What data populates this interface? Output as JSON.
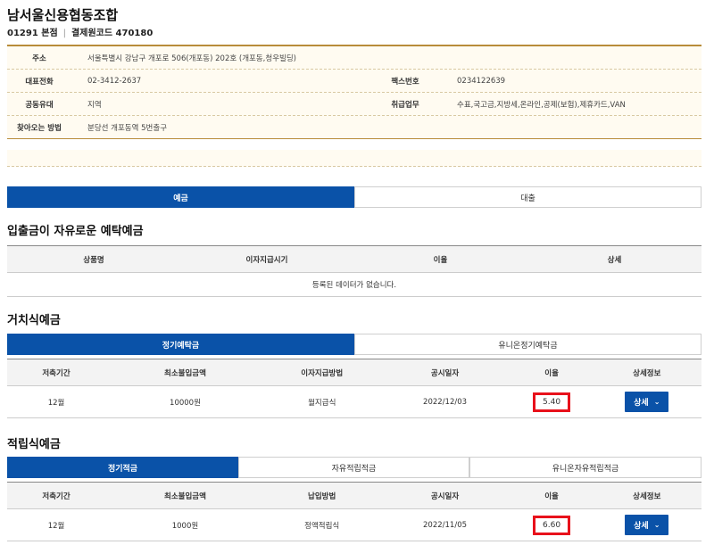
{
  "header": {
    "title": "남서울신용협동조합",
    "branch": "01291 본점",
    "separator": "|",
    "settlement_code": "결제원코드 470180"
  },
  "info": {
    "address_label": "주소",
    "address": "서울특별시 강남구 개포로 506(개포동) 202호 (개포동,청우빌딩)",
    "phone_label": "대표전화",
    "phone": "02-3412-2637",
    "fax_label": "팩스번호",
    "fax": "0234122639",
    "union_label": "공동유대",
    "union": "지역",
    "business_label": "취급업무",
    "business": "수표,국고금,지방세,온라인,공제(보험),제휴카드,VAN",
    "directions_label": "찾아오는 방법",
    "directions": "분당선 개포동역 5번출구"
  },
  "main_tabs": [
    "예금",
    "대출"
  ],
  "section1": {
    "title": "입출금이 자유로운 예탁예금",
    "columns": [
      "상품명",
      "이자지급시기",
      "이율",
      "상세"
    ],
    "empty_message": "등록된 데이터가 없습니다."
  },
  "section2": {
    "title": "거치식예금",
    "tabs": [
      "정기예탁금",
      "유니온정기예탁금"
    ],
    "columns": [
      "저축기간",
      "최소불입금액",
      "이자지급방법",
      "공시일자",
      "이율",
      "상세정보"
    ],
    "row": {
      "period": "12월",
      "min_amount": "10000원",
      "method": "월지급식",
      "date": "2022/12/03",
      "rate": "5.40",
      "detail": "상세"
    }
  },
  "section3": {
    "title": "적립식예금",
    "tabs": [
      "정기적금",
      "자유적립적금",
      "유니온자유적립적금"
    ],
    "columns": [
      "저축기간",
      "최소불입금액",
      "납입방법",
      "공시일자",
      "이율",
      "상세정보"
    ],
    "row": {
      "period": "12월",
      "min_amount": "1000원",
      "method": "정액적립식",
      "date": "2022/11/05",
      "rate": "6.60",
      "detail": "상세"
    }
  },
  "icons": {
    "detail_chevron": "chevron-down-icon"
  },
  "colors": {
    "primary": "#0a52a8",
    "accent_border": "#b88c3a",
    "highlight": "#e8111b"
  }
}
